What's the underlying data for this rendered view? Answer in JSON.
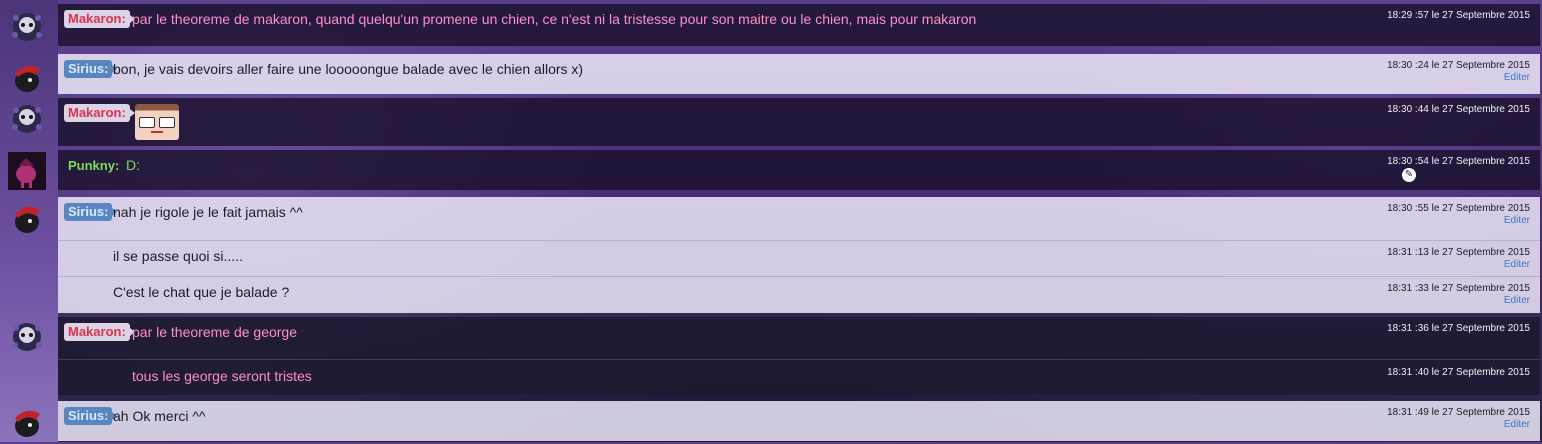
{
  "colors": {
    "makaron_nick": "#d9344d",
    "sirius_nick_bg": "#5a86c0",
    "punkny_nick": "#7fdc5a",
    "pink_text": "#ff8fc6",
    "edit_link": "#3b78c4"
  },
  "messages": [
    {
      "nick": "Makaron:",
      "text": "par le theoreme de makaron, quand quelqu'un promene un chien, ce n'est ni la tristesse pour son maitre ou le chien, mais pour makaron",
      "time": "18:29 :57 le 27 Septembre 2015"
    },
    {
      "nick": "Sirius:",
      "text": "bon, je vais devoirs aller faire une looooongue balade avec le chien allors x)",
      "time": "18:30 :24 le 27 Septembre 2015",
      "edit": "Editer"
    },
    {
      "nick": "Makaron:",
      "emoji": "face-emoji",
      "time": "18:30 :44 le 27 Septembre 2015"
    },
    {
      "nick": "Punkny:",
      "text": "D:",
      "time": "18:30 :54 le 27 Septembre 2015"
    },
    {
      "nick": "Sirius:",
      "text": "nah je rigole je le fait jamais ^^",
      "time": "18:30 :55 le 27 Septembre 2015",
      "edit": "Editer"
    },
    {
      "text": "il se passe quoi si.....",
      "time": "18:31 :13 le 27 Septembre 2015",
      "edit": "Editer"
    },
    {
      "text": "C'est le chat que je balade ?",
      "time": "18:31 :33 le 27 Septembre 2015",
      "edit": "Editer"
    },
    {
      "nick": "Makaron:",
      "text": "par le theoreme de george",
      "time": "18:31 :36 le 27 Septembre 2015"
    },
    {
      "text": "tous les george seront tristes",
      "time": "18:31 :40 le 27 Septembre 2015"
    },
    {
      "nick": "Sirius:",
      "text": "ah Ok merci ^^",
      "time": "18:31 :49 le 27 Septembre 2015",
      "edit": "Editer"
    }
  ]
}
